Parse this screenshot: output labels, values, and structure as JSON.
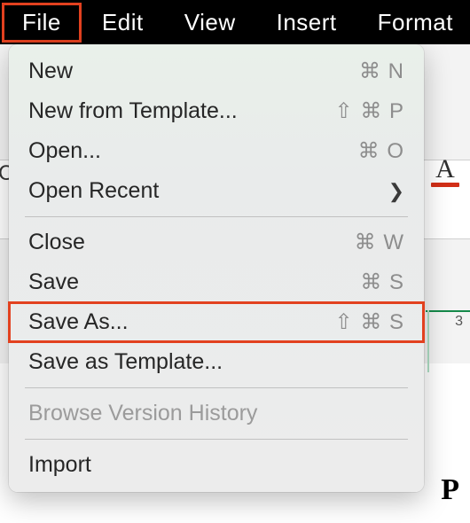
{
  "menubar": {
    "items": [
      {
        "label": "File"
      },
      {
        "label": "Edit"
      },
      {
        "label": "View"
      },
      {
        "label": "Insert"
      },
      {
        "label": "Format"
      }
    ]
  },
  "menu": {
    "new": {
      "label": "New",
      "shortcut": "⌘ N"
    },
    "new_template": {
      "label": "New from Template...",
      "shortcut": "⇧ ⌘ P"
    },
    "open": {
      "label": "Open...",
      "shortcut": "⌘ O"
    },
    "open_recent": {
      "label": "Open Recent"
    },
    "close": {
      "label": "Close",
      "shortcut": "⌘ W"
    },
    "save": {
      "label": "Save",
      "shortcut": "⌘ S"
    },
    "save_as": {
      "label": "Save As...",
      "shortcut": "⇧ ⌘ S"
    },
    "save_template": {
      "label": "Save as Template..."
    },
    "browse_history": {
      "label": "Browse Version History"
    },
    "import": {
      "label": "Import"
    }
  },
  "background": {
    "side_char": "C",
    "font_color_button": "A",
    "row_number": "3",
    "big_glyph": "P"
  }
}
